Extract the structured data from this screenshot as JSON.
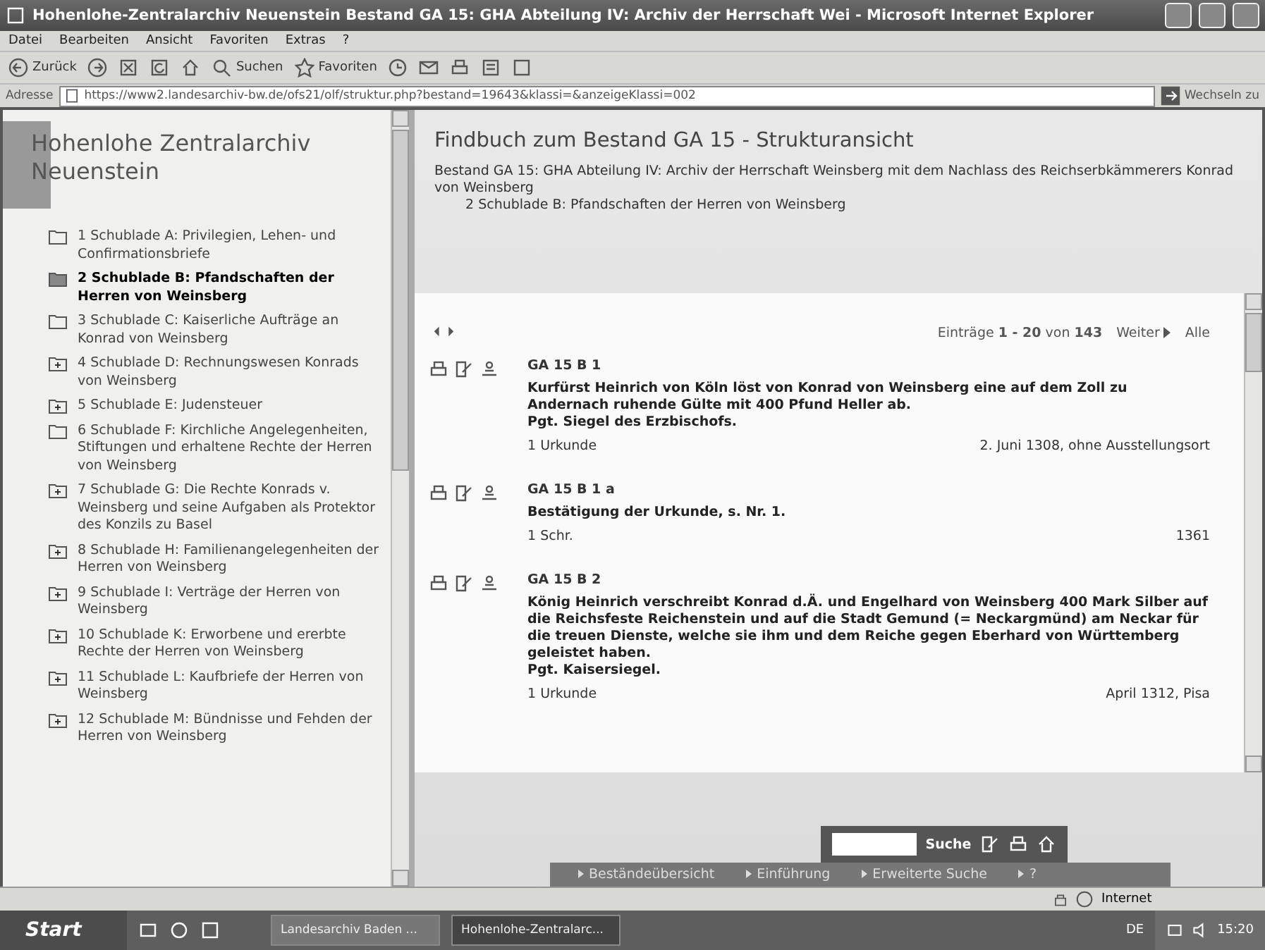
{
  "window": {
    "title": "Hohenlohe-Zentralarchiv Neuenstein   Bestand GA 15: GHA Abteilung IV: Archiv der Herrschaft Wei - Microsoft Internet Explorer"
  },
  "menu": [
    "Datei",
    "Bearbeiten",
    "Ansicht",
    "Favoriten",
    "Extras",
    "?"
  ],
  "toolbar": {
    "back": "Zurück",
    "search": "Suchen",
    "favorites": "Favoriten"
  },
  "address": {
    "label": "Adresse",
    "value": "https://www2.landesarchiv-bw.de/ofs21/olf/struktur.php?bestand=19643&klassi=&anzeigeKlassi=002",
    "go": "Wechseln zu"
  },
  "sidebar": {
    "title": "Hohenlohe Zentralarchiv Neuenstein",
    "items": [
      {
        "label": "1 Schublade A: Privilegien, Lehen- und Confirmationsbriefe",
        "kind": "plain",
        "selected": false
      },
      {
        "label": "2 Schublade B: Pfandschaften der Herren von Weinsberg",
        "kind": "plain",
        "selected": true
      },
      {
        "label": "3 Schublade C: Kaiserliche Aufträge an Konrad von Weinsberg",
        "kind": "plain",
        "selected": false
      },
      {
        "label": "4 Schublade D: Rechnungswesen Konrads von Weinsberg",
        "kind": "expandable",
        "selected": false
      },
      {
        "label": "5 Schublade E: Judensteuer",
        "kind": "expandable",
        "selected": false
      },
      {
        "label": "6 Schublade F: Kirchliche Angelegenheiten, Stiftungen und erhaltene Rechte der Herren von Weinsberg",
        "kind": "plain",
        "selected": false
      },
      {
        "label": "7 Schublade G: Die Rechte Konrads v. Weinsberg und seine Aufgaben als Protektor des Konzils zu Basel",
        "kind": "expandable",
        "selected": false
      },
      {
        "label": "8 Schublade H: Familienangelegenheiten der Herren von Weinsberg",
        "kind": "expandable",
        "selected": false
      },
      {
        "label": "9 Schublade I: Verträge der Herren von Weinsberg",
        "kind": "expandable",
        "selected": false
      },
      {
        "label": "10 Schublade K: Erworbene und ererbte Rechte der Herren von Weinsberg",
        "kind": "expandable",
        "selected": false
      },
      {
        "label": "11 Schublade L: Kaufbriefe der Herren von Weinsberg",
        "kind": "expandable",
        "selected": false
      },
      {
        "label": "12 Schublade M: Bündnisse und Fehden der Herren von Weinsberg",
        "kind": "expandable",
        "selected": false
      }
    ]
  },
  "main": {
    "title": "Findbuch zum Bestand GA 15 - Strukturansicht",
    "breadcrumb": "Bestand GA 15: GHA Abteilung IV: Archiv der Herrschaft Weinsberg mit dem Nachlass des Reichserbkämmerers Konrad von Weinsberg",
    "sub": "2 Schublade B: Pfandschaften der Herren von Weinsberg",
    "paging": "Einträge **1 - 20** von **143**",
    "next": "Weiter",
    "all": "Alle",
    "entries": [
      {
        "signature": "GA 15 B 1",
        "text": "Kurfürst Heinrich von Köln löst von Konrad von Weinsberg eine auf dem Zoll zu Andernach ruhende Gülte mit 400 Pfund Heller ab.\nPgt. Siegel des Erzbischofs.",
        "extent": "1 Urkunde",
        "date": "2. Juni 1308, ohne Ausstellungsort"
      },
      {
        "signature": "GA 15 B 1 a",
        "text": "Bestätigung der Urkunde, s. Nr. 1.",
        "extent": "1 Schr.",
        "date": "1361"
      },
      {
        "signature": "GA 15 B 2",
        "text": "König Heinrich verschreibt Konrad d.Ä. und Engelhard von Weinsberg 400 Mark Silber auf die Reichsfeste Reichenstein und auf die Stadt Gemund (= Neckargmünd) am Neckar für die treuen Dienste, welche sie ihm und dem Reiche gegen Eberhard von Württemberg geleistet haben.\nPgt. Kaisersiegel.",
        "extent": "1 Urkunde",
        "date": "April 1312, Pisa"
      }
    ]
  },
  "search": {
    "button": "Suche"
  },
  "links": [
    "Beständeübersicht",
    "Einführung",
    "Erweiterte Suche",
    "?"
  ],
  "status_bar": {
    "zone": "Internet"
  },
  "taskbar": {
    "start": "Start",
    "tasks": [
      {
        "label": "Landesarchiv Baden ...",
        "selected": false
      },
      {
        "label": "Hohenlohe-Zentralarc...",
        "selected": true
      }
    ],
    "lang": "DE",
    "clock": "15:20"
  }
}
